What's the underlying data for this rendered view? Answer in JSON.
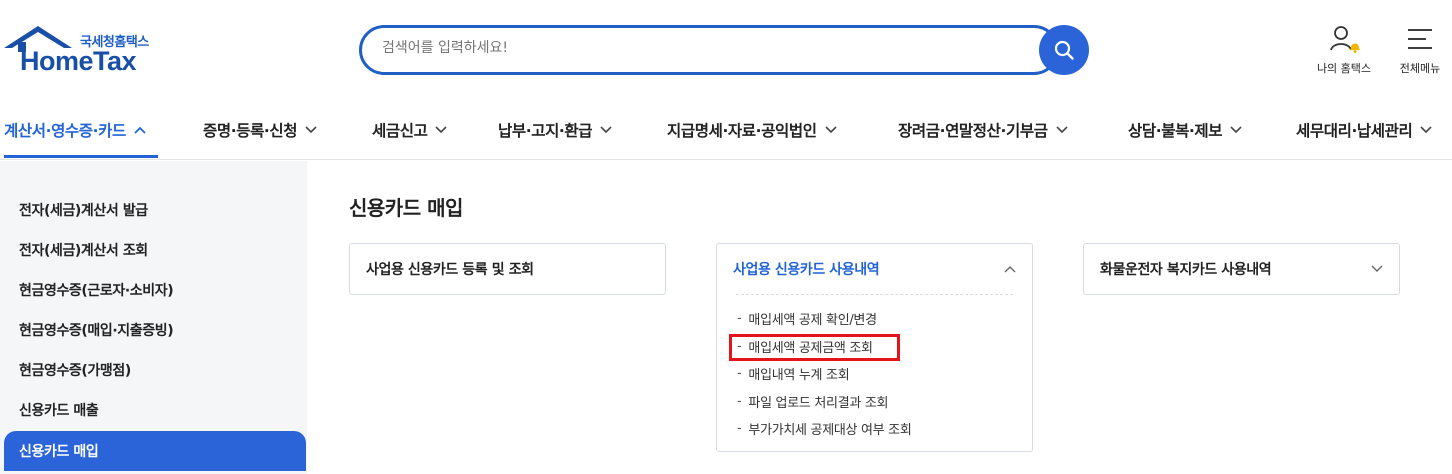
{
  "header": {
    "logo_small": "국세청홈택스",
    "logo_big": "HomeTax",
    "search_placeholder": "검색어를 입력하세요!",
    "my_hometax_label": "나의 홈택스",
    "all_menu_label": "전체메뉴"
  },
  "nav": {
    "items": [
      {
        "label": "계산서·영수증·카드",
        "active": true
      },
      {
        "label": "증명·등록·신청"
      },
      {
        "label": "세금신고"
      },
      {
        "label": "납부·고지·환급"
      },
      {
        "label": "지급명세·자료·공익법인"
      },
      {
        "label": "장려금·연말정산·기부금"
      },
      {
        "label": "상담·불복·제보"
      },
      {
        "label": "세무대리·납세관리"
      }
    ]
  },
  "sidebar": {
    "items": [
      {
        "label": "전자(세금)계산서 발급"
      },
      {
        "label": "전자(세금)계산서 조회"
      },
      {
        "label": "현금영수증(근로자·소비자)"
      },
      {
        "label": "현금영수증(매입·지출증빙)"
      },
      {
        "label": "현금영수증(가맹점)"
      },
      {
        "label": "신용카드 매출"
      },
      {
        "label": "신용카드 매입",
        "active": true
      }
    ]
  },
  "main": {
    "title": "신용카드 매입",
    "cards": [
      {
        "title": "사업용 신용카드 등록 및 조회"
      },
      {
        "title": "사업용 신용카드 사용내역",
        "expanded": true,
        "sub_items": [
          "매입세액 공제 확인/변경",
          "매입세액 공제금액 조회",
          "매입내역 누계 조회",
          "파일 업로드 처리결과 조회",
          "부가가치세 공제대상 여부 조회"
        ],
        "highlighted_index": 1
      },
      {
        "title": "화물운전자 복지카드 사용내역"
      }
    ]
  },
  "colors": {
    "brand_blue": "#2264d8",
    "highlight_red": "#e3141c",
    "sidebar_bg": "#f5f6f8"
  }
}
